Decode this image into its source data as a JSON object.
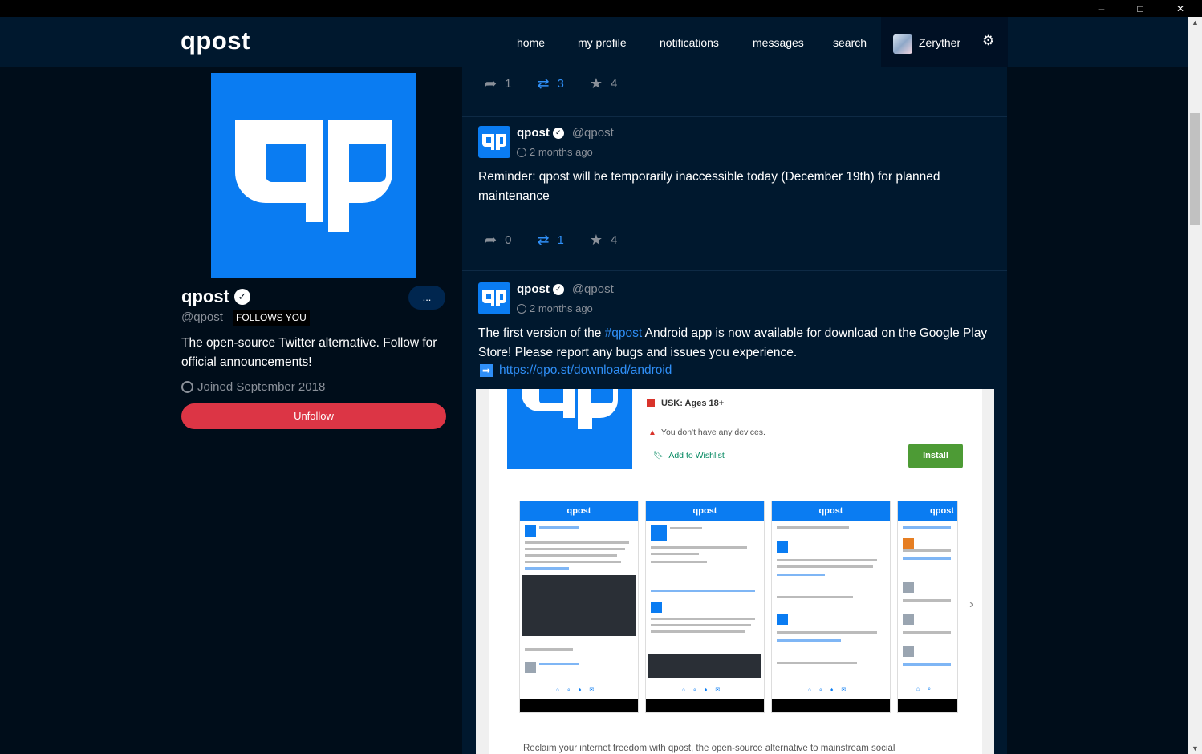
{
  "window": {
    "minimize_glyph": "–",
    "maximize_glyph": "□",
    "close_glyph": "✕"
  },
  "nav": {
    "logo": "qpost",
    "items": [
      "home",
      "my profile",
      "notifications",
      "messages",
      "search"
    ],
    "username": "Zeryther",
    "settings_icon": "gear-icon"
  },
  "profile": {
    "name": "qpost",
    "handle": "@qpost",
    "follows_you": "FOLLOWS YOU",
    "bio": "The open-source Twitter alternative. Follow for official announcements!",
    "joined": "Joined September 2018",
    "unfollow_label": "Unfollow",
    "more_label": "...",
    "unfollow_color": "#dc3545",
    "brand_color": "#0a7cf2"
  },
  "feed": {
    "top_actions": {
      "replies": "1",
      "boosts": "3",
      "favorites": "4"
    },
    "posts": [
      {
        "author": "qpost",
        "handle": "@qpost",
        "time": "2 months ago",
        "text": "Reminder: qpost will be temporarily inaccessible today (December 19th) for planned maintenance",
        "replies": "0",
        "boosts": "1",
        "favorites": "4"
      },
      {
        "author": "qpost",
        "handle": "@qpost",
        "time": "2 months ago",
        "text_before": "The first version of the ",
        "hashtag": "#qpost",
        "text_after": " Android app is now available for download on the Google Play Store! Please report any bugs and issues you experience.",
        "link": "https://qpo.st/download/android"
      }
    ]
  },
  "embed": {
    "usk": "USK: Ages 18+",
    "no_devices": "You don't have any devices.",
    "wishlist": "Add to Wishlist",
    "install": "Install",
    "shot_title": "qpost",
    "reclaim": "Reclaim your internet freedom with qpost, the open-source alternative to mainstream social",
    "install_color": "#4d9b35"
  }
}
